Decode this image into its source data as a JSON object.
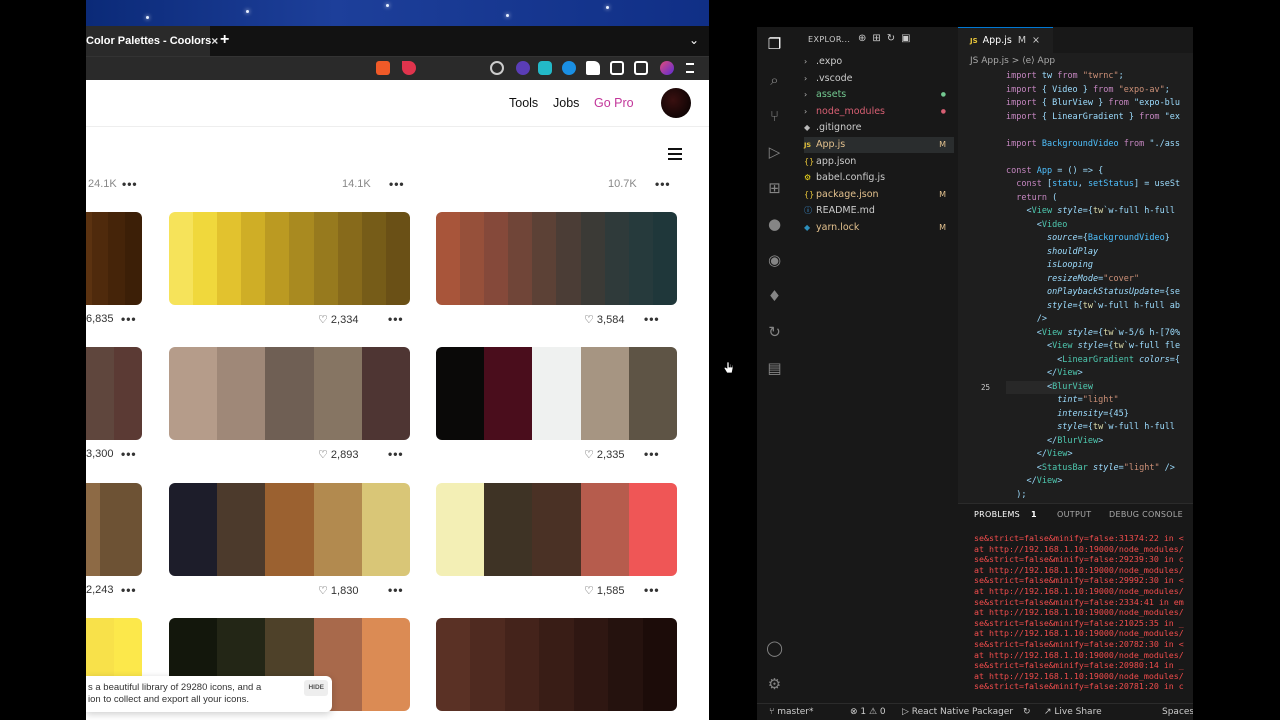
{
  "browser": {
    "tab_title": "Color Palettes - Coolors",
    "tab_close": "×",
    "new_tab": "+",
    "tab_menu": "⌄",
    "nav": {
      "tools": "Tools",
      "jobs": "Jobs",
      "go_pro": "Go Pro"
    },
    "top_counts": [
      "24.1K",
      "14.1K",
      "10.7K"
    ],
    "palettes": [
      {
        "colors": [
          "#6b3d12",
          "#5b3210",
          "#4f2a0c",
          "#452409",
          "#3c1f07"
        ],
        "likes": "6,835"
      },
      {
        "colors": [
          "#f6e35a",
          "#f0d83c",
          "#e2c22e",
          "#cfae26",
          "#bb9a22",
          "#a98a20",
          "#977a1e",
          "#876a1b",
          "#765c18",
          "#6a5016"
        ],
        "likes": "2,334"
      },
      {
        "colors": [
          "#a8553a",
          "#96503a",
          "#85493a",
          "#704538",
          "#5c4136",
          "#4b3d36",
          "#3b3a36",
          "#2f3a3a",
          "#263a3c",
          "#1f373a"
        ],
        "likes": "3,584"
      },
      {
        "colors": [
          "#7e8075",
          "#5f463d",
          "#5b3a34"
        ],
        "likes": "3,300"
      },
      {
        "colors": [
          "#b59c8a",
          "#9f8878",
          "#6f5f54",
          "#867563",
          "#4e3533"
        ],
        "likes": "2,893"
      },
      {
        "colors": [
          "#0a0908",
          "#4a0d1c",
          "#eff1f0",
          "#a69582",
          "#5e5445"
        ],
        "likes": "2,335"
      },
      {
        "colors": [
          "#8d6a45",
          "#6d5234"
        ],
        "likes": "2,243"
      },
      {
        "colors": [
          "#1d1d2a",
          "#4c3a2c",
          "#9b6130",
          "#b28a4f",
          "#d9c677"
        ],
        "likes": "1,830"
      },
      {
        "colors": [
          "#f3efb5",
          "#3e3325",
          "#4a3125",
          "#b65c4d",
          "#ef5656"
        ],
        "likes": "1,585"
      },
      {
        "colors": [
          "#f3b431",
          "#f8e14a",
          "#fce84b"
        ],
        "likes": ""
      },
      {
        "colors": [
          "#13170c",
          "#232616",
          "#4e4129",
          "#a8694b",
          "#db8b54"
        ],
        "likes": ""
      },
      {
        "colors": [
          "#5a3125",
          "#4f2a20",
          "#44231b",
          "#391d16",
          "#2f1712",
          "#25120e",
          "#1c0c09"
        ],
        "likes": ""
      }
    ],
    "more": "•••",
    "toast": {
      "line1": "s a beautiful library of 29280 icons, and a",
      "line2": "ion to collect and export all your icons.",
      "hide": "HIDE"
    }
  },
  "vscode": {
    "explorer_title": "EXPLOR...",
    "files": [
      {
        "icon": "›",
        "name": ".expo",
        "color": "#cccccc",
        "badge": ""
      },
      {
        "icon": "›",
        "name": ".vscode",
        "color": "#cccccc",
        "badge": ""
      },
      {
        "icon": "›",
        "name": "assets",
        "color": "#73c991",
        "badge": "●"
      },
      {
        "icon": "›",
        "name": "node_modules",
        "color": "#d85f73",
        "badge": "●"
      },
      {
        "icon": "◆",
        "name": ".gitignore",
        "color": "#cccccc",
        "badge": ""
      },
      {
        "icon": "JS",
        "name": "App.js",
        "color": "#e2c08d",
        "badge": "M"
      },
      {
        "icon": "{}",
        "name": "app.json",
        "color": "#cccccc",
        "badge": ""
      },
      {
        "icon": "⚙",
        "name": "babel.config.js",
        "color": "#cccccc",
        "badge": ""
      },
      {
        "icon": "{}",
        "name": "package.json",
        "color": "#e2c08d",
        "badge": "M"
      },
      {
        "icon": "ⓘ",
        "name": "README.md",
        "color": "#cccccc",
        "badge": ""
      },
      {
        "icon": "◆",
        "name": "yarn.lock",
        "color": "#e2c08d",
        "badge": "M"
      }
    ],
    "editor_tab": {
      "lang": "JS",
      "name": "App.js",
      "mod": "M",
      "close": "×"
    },
    "breadcrumb": "JS App.js > ⟨e⟩ App",
    "line_numbers": [
      "",
      "",
      "",
      "",
      "",
      "",
      "",
      "",
      "",
      "",
      "",
      "",
      "",
      "",
      "",
      "",
      "",
      "",
      "",
      "",
      "",
      "",
      "",
      "25",
      "",
      "",
      "",
      "",
      "",
      "",
      "",
      "",
      "",
      "",
      ""
    ],
    "code": [
      "import tw from \"twrnc\";",
      "import { Video } from \"expo-av\";",
      "import { BlurView } from \"expo-blu",
      "import { LinearGradient } from \"ex",
      "",
      "import BackgroundVideo from \"./ass",
      "",
      "const App = () => {",
      "  const [statu, setStatus] = useSt",
      "  return (",
      "    <View style={tw`w-full h-full",
      "      <Video",
      "        source={BackgroundVideo}",
      "        shouldPlay",
      "        isLooping",
      "        resizeMode=\"cover\"",
      "        onPlaybackStatusUpdate={se",
      "        style={tw`w-full h-full ab",
      "      />",
      "      <View style={tw`w-5/6 h-[70%",
      "        <View style={tw`w-full fle",
      "          <LinearGradient colors={",
      "        </View>",
      "        <BlurView",
      "          tint=\"light\"",
      "          intensity={45}",
      "          style={tw`w-full h-full",
      "        </BlurView>",
      "      </View>",
      "      <StatusBar style=\"light\" />",
      "    </View>",
      "  );"
    ],
    "panel_tabs": {
      "problems": "PROBLEMS",
      "count": "1",
      "output": "OUTPUT",
      "debug": "DEBUG CONSOLE"
    },
    "logs": [
      "se&strict=false&minify=false:31374:22 in <",
      "at http://192.168.1.10:19000/node_modules/",
      "se&strict=false&minify=false:29239:30 in c",
      "at http://192.168.1.10:19000/node_modules/",
      "se&strict=false&minify=false:29992:30 in <",
      "at http://192.168.1.10:19000/node_modules/",
      "se&strict=false&minify=false:2334:41 in em",
      "at http://192.168.1.10:19000/node_modules/",
      "se&strict=false&minify=false:21025:35 in _",
      "at http://192.168.1.10:19000/node_modules/",
      "se&strict=false&minify=false:20782:30 in <",
      "at http://192.168.1.10:19000/node_modules/",
      "se&strict=false&minify=false:20980:14 in _",
      "at http://192.168.1.10:19000/node_modules/",
      "se&strict=false&minify=false:20781:20 in c"
    ],
    "status": {
      "branch": "master*",
      "problems": "⊗ 1 ⚠ 0",
      "packager": "React Native Packager",
      "liveshare": "Live Share",
      "spaces": "Spaces"
    }
  }
}
